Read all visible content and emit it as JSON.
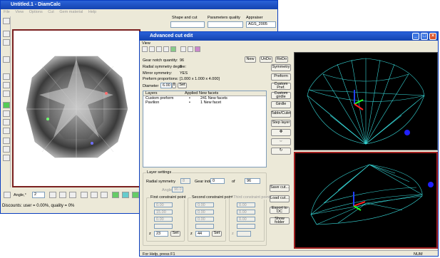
{
  "back_window": {
    "title": "Untitled.1 - DiamCalc",
    "menu": [
      "File",
      "View",
      "Options",
      "Cut",
      "Gem material",
      "Help"
    ],
    "toolbar": {
      "shape_and_cut": "Shape and cut",
      "parameters_quality": "Parameters quality",
      "appraiser": "Appraiser",
      "appraiser_value": "AGS_2005"
    },
    "angle_label": "Angle,°",
    "angle_value": "2",
    "status": "Discounts: user = 0.00%, quality = 0%"
  },
  "dialog": {
    "title": "Advanced cut edit",
    "menu": "View",
    "info": {
      "gear_notch_label": "Gear notch quantity:",
      "gear_notch_value": "96",
      "radial_label": "Radial symmetry degree:",
      "radial_value": "8",
      "mirror_label": "Mirror symmetry:",
      "mirror_value": "YES",
      "preform_label": "Preform proportions:",
      "preform_value": "[1.000 x 1.000 x 4.000]",
      "diameter_label": "Diameter",
      "diameter_value": "6.00",
      "set_label": "Set"
    },
    "top_buttons": {
      "new": "New",
      "undo": "UnDo",
      "redo": "ReDo"
    },
    "right_buttons": [
      "Symmetry",
      "Preform",
      "Custom Pref.",
      "Custom girdle",
      "Girdle",
      "Table/Culet",
      "Step layer"
    ],
    "arrow_buttons": [
      "✥",
      "⇔",
      "↻"
    ],
    "table": {
      "headers": [
        "Layers",
        "Applied",
        "New facets"
      ],
      "rows": [
        {
          "layer": "Custom preform",
          "applied": "•",
          "facets": "241 New facets"
        },
        {
          "layer": "Pavilion",
          "applied": "•",
          "facets": "1 New facet"
        }
      ]
    },
    "layer_settings": {
      "title": "Layer settings",
      "radial_label": "Radial symmetry",
      "radial_value": "8",
      "gear_index_label": "Gear index",
      "gear_index_value": "0",
      "of_label": "of",
      "of_value": "96",
      "angle_label": "Angle",
      "angle_value": "90.0",
      "first_point": {
        "title": "First constraint point",
        "f": "0.00",
        "phi": "15.00",
        "fi": "0.00",
        "z_label": "z",
        "z_value": "23",
        "set": "Set"
      },
      "second_point": {
        "title": "Second constraint point",
        "f": "0.00",
        "phi": "0.00",
        "fi": "0.00",
        "z_label": "z",
        "z_value": "44",
        "set": "Set"
      },
      "third_point": {
        "title": "Third constraint point",
        "f": "0.00",
        "phi": "0.00",
        "fi": "0.00",
        "z_label": "z"
      }
    },
    "side_buttons": [
      "Save cut...",
      "Load cut...",
      "Export to DC",
      "Show folder"
    ],
    "status": {
      "help": "For Help, press F1",
      "num": "NUM"
    },
    "colors": {
      "wireframe": "#36d6d6",
      "viewport_bg": "#000000",
      "selected_border": "#a02020",
      "marker": "#2020ff"
    }
  }
}
